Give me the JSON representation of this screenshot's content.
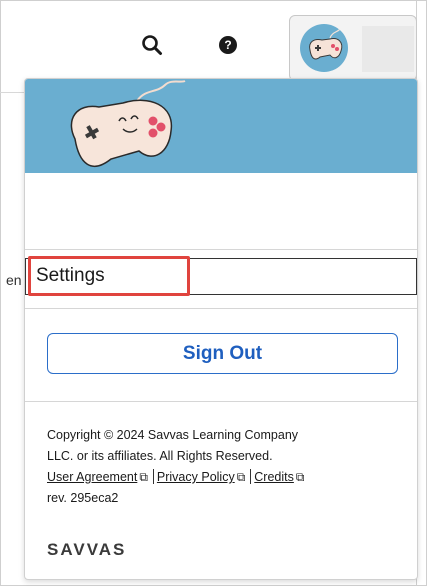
{
  "background": {
    "behind_text": "en"
  },
  "header": {
    "search_icon": "search-icon",
    "help_icon": "help-icon",
    "help_glyph": "?",
    "avatar_icon": "game-controller-avatar"
  },
  "menu": {
    "settings_label": "Settings",
    "sign_out_label": "Sign Out"
  },
  "footer": {
    "copyright_line1": "Copyright © 2024 Savvas Learning Company",
    "copyright_line2": "LLC. or its affiliates. All Rights Reserved.",
    "links": {
      "user_agreement": "User Agreement",
      "privacy_policy": "Privacy Policy",
      "credits": "Credits"
    },
    "external_link_icon": "external-link-icon",
    "revision": "rev. 295eca2",
    "brand": "SAVVAS"
  },
  "colors": {
    "banner": "#6aaed0",
    "sign_out": "#1f5fbf",
    "highlight": "#e0443e"
  }
}
